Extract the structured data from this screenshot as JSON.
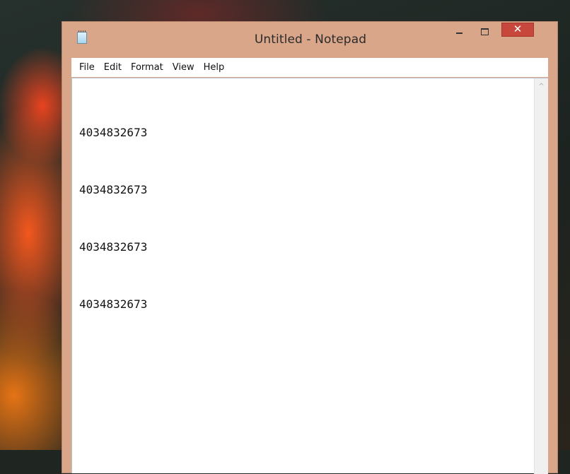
{
  "window": {
    "title": "Untitled - Notepad",
    "controls": {
      "minimize_icon": "minimize-icon",
      "maximize_icon": "maximize-icon",
      "close_label": "✕"
    },
    "accent_color": "#d9a68a",
    "close_color": "#c7473d"
  },
  "menu": {
    "items": [
      {
        "label": "File"
      },
      {
        "label": "Edit"
      },
      {
        "label": "Format"
      },
      {
        "label": "View"
      },
      {
        "label": "Help"
      }
    ]
  },
  "editor": {
    "lines": [
      "4034832673",
      "4034832673",
      "4034832673",
      "4034832673"
    ]
  },
  "scrollbar": {
    "up_arrow": "^"
  }
}
